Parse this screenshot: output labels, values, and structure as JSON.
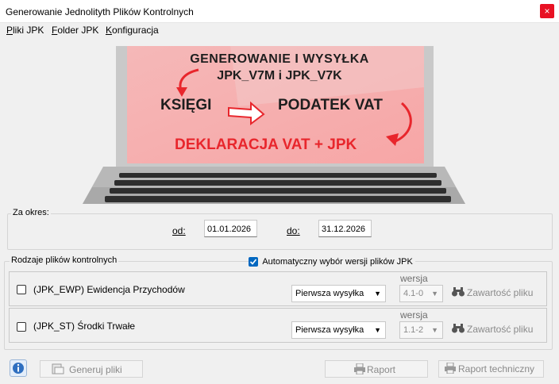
{
  "window": {
    "title": "Generowanie Jednolityth Plików Kontrolnych",
    "close_symbol": "×"
  },
  "menu": [
    {
      "key": "P",
      "rest": "liki JPK"
    },
    {
      "key": "F",
      "rest": "older JPK"
    },
    {
      "key": "K",
      "rest": "onfiguracja"
    }
  ],
  "banner": {
    "line1": "GENEROWANIE I WYSYŁKA",
    "line2": "JPK_V7M i JPK_V7K",
    "left_word": "KSIĘGI",
    "right_word": "PODATEK VAT",
    "bottom": "DEKLARACJA VAT + JPK",
    "accent": "#e8262c"
  },
  "period": {
    "legend": "Za okres:",
    "from_label": "od:",
    "from_value": "01.01.2026",
    "to_label": "do:",
    "to_value": "31.12.2026"
  },
  "files": {
    "legend": "Rodzaje plików kontrolnych",
    "auto_version_label": "Automatyczny wybór wersji plików JPK",
    "auto_version_checked": true,
    "version_header": "wersja",
    "rows": [
      {
        "name": "(JPK_EWP) Ewidencja Przychodów",
        "send_type": "Pierwsza wysyłka",
        "version": "4.1-0",
        "content_button": "Zawartość pliku"
      },
      {
        "name": "(JPK_ST) Środki Trwałe",
        "send_type": "Pierwsza wysyłka",
        "version": "1.1-2",
        "content_button": "Zawartość pliku"
      }
    ]
  },
  "footer": {
    "generate": "Generuj pliki",
    "report": "Raport",
    "tech_report": "Raport techniczny"
  }
}
